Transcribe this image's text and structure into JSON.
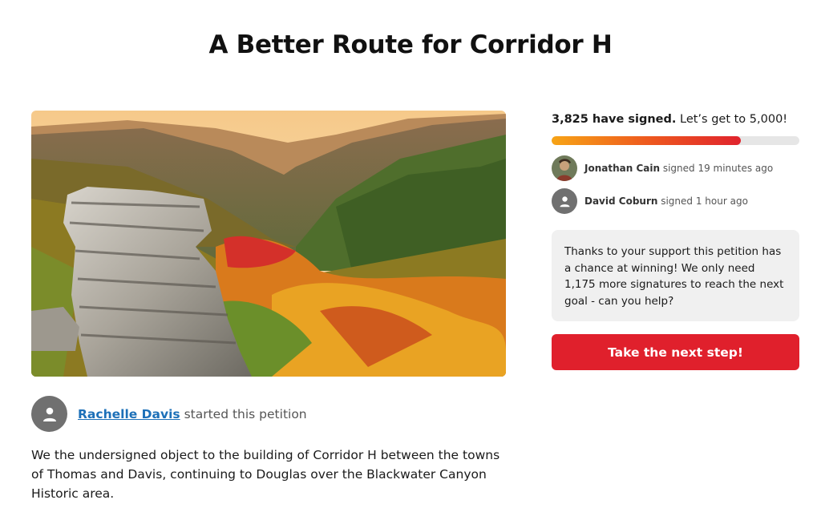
{
  "page": {
    "title": "A Better Route for Corridor H"
  },
  "hero": {
    "icon": "landscape-photo"
  },
  "author": {
    "name": "Rachelle Davis",
    "action": " started this petition"
  },
  "description": "We the undersigned object to the building of Corridor H between the towns of Thomas and Davis, continuing to Douglas over the Blackwater Canyon Historic area.",
  "signatures": {
    "count_text": "3,825 have signed.",
    "goal_text": " Let’s get to 5,000!",
    "progress_fraction": 0.765,
    "progress_colors": [
      "#f7a416",
      "#ee5a1e",
      "#e0232d"
    ]
  },
  "recent_signers": [
    {
      "name": "Jonathan Cain",
      "action": " signed 19 minutes ago"
    },
    {
      "name": "David Coburn",
      "action": " signed 1 hour ago"
    }
  ],
  "info_box": {
    "text": "Thanks to your support this petition has a chance at winning! We only need 1,175 more signatures to reach the next goal - can you help?"
  },
  "cta": {
    "label": "Take the next step!",
    "color": "#e0202c"
  }
}
